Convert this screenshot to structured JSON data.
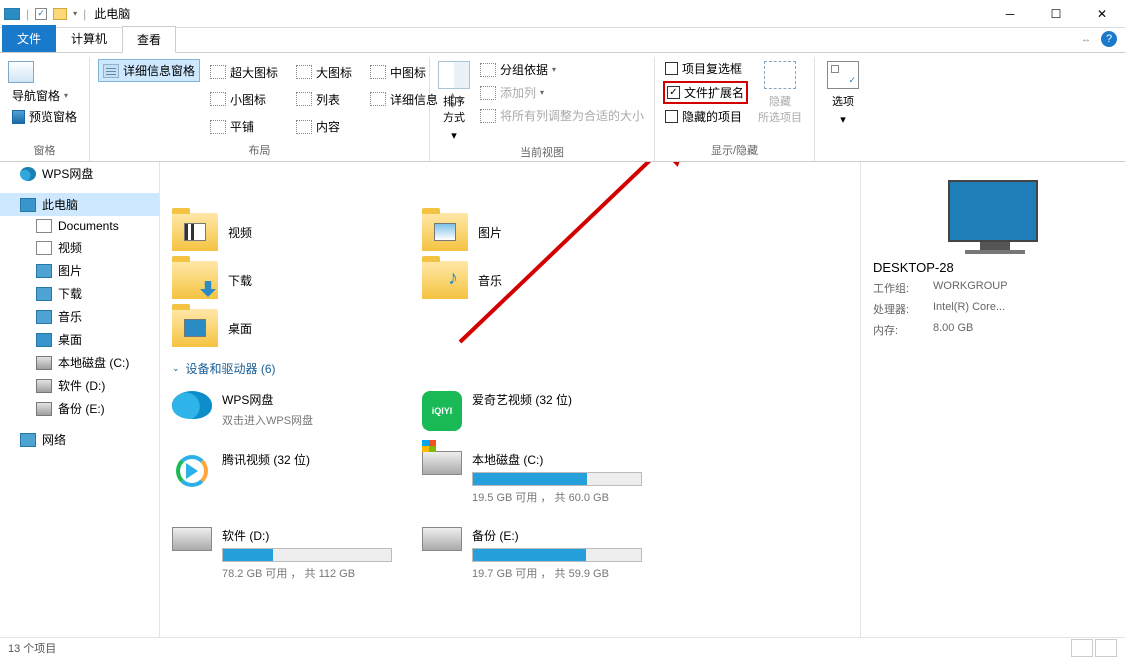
{
  "titlebar": {
    "title": "此电脑"
  },
  "tabs": {
    "file": "文件",
    "computer": "计算机",
    "view": "查看"
  },
  "ribbon": {
    "panes": {
      "nav": "导航窗格",
      "preview": "预览窗格",
      "label": "窗格"
    },
    "layout": {
      "details_pane": "详细信息窗格",
      "xl": "超大图标",
      "lg": "大图标",
      "md": "中图标",
      "sm": "小图标",
      "list": "列表",
      "details": "详细信息",
      "tiles": "平铺",
      "content": "内容",
      "label": "布局"
    },
    "view": {
      "sort": "排序方式",
      "group": "分组依据",
      "addcol": "添加列",
      "fitcols": "将所有列调整为合适的大小",
      "label": "当前视图"
    },
    "showhide": {
      "itemcheck": "项目复选框",
      "fileext": "文件扩展名",
      "hidden": "隐藏的项目",
      "hide": "隐藏\n所选项目",
      "label": "显示/隐藏"
    },
    "options": {
      "options": "选项"
    }
  },
  "sidebar": {
    "items": [
      {
        "label": "WPS网盘",
        "icon": "ic-cloud"
      },
      {
        "label": "此电脑",
        "icon": "ic-pc",
        "sel": true
      },
      {
        "label": "Documents",
        "icon": "ic-doc"
      },
      {
        "label": "视频",
        "icon": "ic-vid"
      },
      {
        "label": "图片",
        "icon": "ic-pic"
      },
      {
        "label": "下载",
        "icon": "ic-down"
      },
      {
        "label": "音乐",
        "icon": "ic-mus"
      },
      {
        "label": "桌面",
        "icon": "ic-desk"
      },
      {
        "label": "本地磁盘 (C:)",
        "icon": "ic-drv"
      },
      {
        "label": "软件 (D:)",
        "icon": "ic-drv"
      },
      {
        "label": "备份 (E:)",
        "icon": "ic-drv"
      },
      {
        "label": "网络",
        "icon": "ic-net"
      }
    ]
  },
  "content": {
    "folders": [
      {
        "label": "视频",
        "t": "v"
      },
      {
        "label": "图片",
        "t": "p"
      },
      {
        "label": "下载",
        "t": "d"
      },
      {
        "label": "音乐",
        "t": "m"
      },
      {
        "label": "桌面",
        "t": "dk"
      }
    ],
    "section": "设备和驱动器 (6)",
    "drives": {
      "wps": {
        "name": "WPS网盘",
        "sub": "双击进入WPS网盘"
      },
      "iqiyi": {
        "name": "爱奇艺视频 (32 位)"
      },
      "tencent": {
        "name": "腾讯视频 (32 位)"
      },
      "c": {
        "name": "本地磁盘 (C:)",
        "free": "19.5 GB 可用 ， 共 60.0 GB",
        "pct": 68
      },
      "d": {
        "name": "软件 (D:)",
        "free": "78.2 GB 可用 ， 共 112 GB",
        "pct": 30
      },
      "e": {
        "name": "备份 (E:)",
        "free": "19.7 GB 可用 ， 共 59.9 GB",
        "pct": 67
      }
    }
  },
  "details": {
    "name": "DESKTOP-28",
    "workgroup_k": "工作组:",
    "workgroup_v": "WORKGROUP",
    "cpu_k": "处理器:",
    "cpu_v": "Intel(R) Core...",
    "mem_k": "内存:",
    "mem_v": "8.00 GB"
  },
  "status": {
    "count": "13 个项目"
  }
}
